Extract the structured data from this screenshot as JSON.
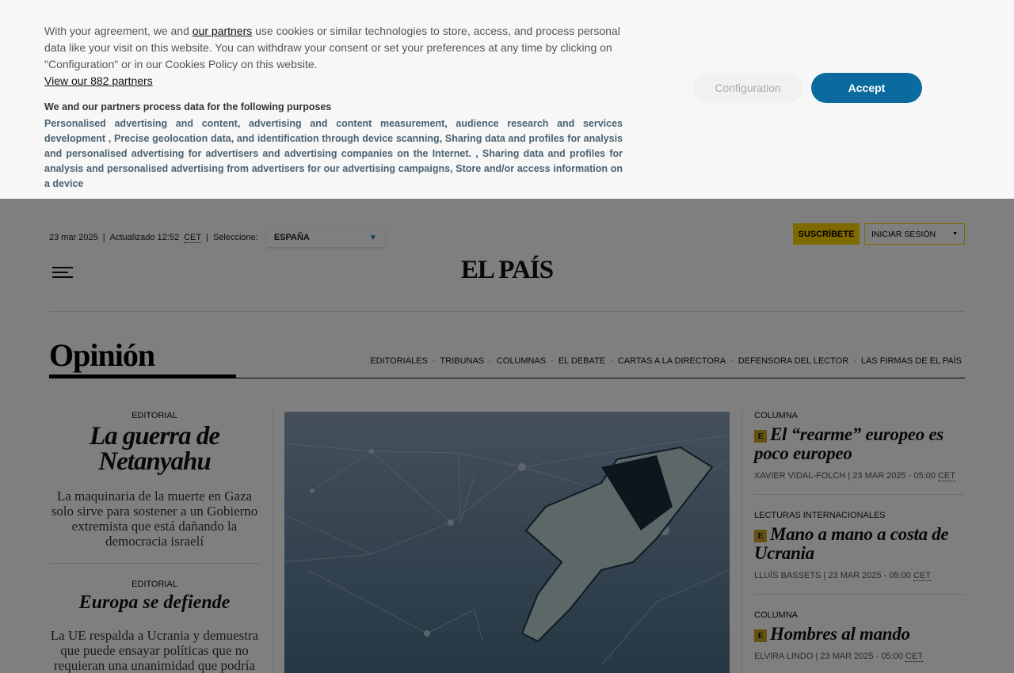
{
  "consent": {
    "text_before": "With your agreement, we and ",
    "partners_link": "our partners",
    "text_after": " use cookies or similar technologies to store, access, and process personal data like your visit on this website. You can withdraw your consent or set your preferences at any time by clicking on \"Configuration\" or in our Cookies Policy on this website.",
    "view_partners": "View our 882 partners",
    "purposes_heading": "We and our partners process data for the following purposes",
    "purposes": "Personalised advertising and content, advertising and content measurement, audience research and services development , Precise geolocation data, and identification through device scanning, Sharing data and profiles for analysis and personalised advertising for advertisers and advertising companies on the Internet. , Sharing data and profiles for analysis and personalised advertising from advertisers for our advertising campaigns, Store and/or access information on a device",
    "configuration": "Configuration",
    "accept": "Accept",
    "accent": "#0b6a9e"
  },
  "header": {
    "date": "23 mar 2025",
    "sep": "|",
    "updated": "Actualizado 12:52",
    "tz": "CET",
    "select_label": "Seleccione:",
    "edition": "ESPAÑA",
    "subscribe": "SUSCRÍBETE",
    "login": "INICIAR SESIÓN",
    "logo": "EL PAÍS",
    "subscribe_color": "#ffd400"
  },
  "section": {
    "title": "Opinión",
    "nav": [
      "EDITORIALES",
      "TRIBUNAS",
      "COLUMNAS",
      "EL DEBATE",
      "CARTAS A LA DIRECTORA",
      "DEFENSORA DEL LECTOR",
      "LAS FIRMAS DE EL PAÍS"
    ]
  },
  "left": [
    {
      "kicker": "EDITORIAL",
      "title": "La guerra de Netanyahu",
      "dek": "La maquinaria de la muerte en Gaza solo sirve para sostener a un Gobierno extremista que está dañando la democracia israelí"
    },
    {
      "kicker": "EDITORIAL",
      "title": "Europa se defiende",
      "dek": "La UE respalda a Ucrania y demuestra que puede ensayar políticas que no requieran una unanimidad que podría"
    }
  ],
  "right": [
    {
      "kicker": "COLUMNA",
      "badge": "E",
      "title": "El “rearme” europeo es poco europeo",
      "author": "XAVIER VIDAL-FOLCH",
      "date": "23 MAR 2025 - 05:00",
      "tz": "CET"
    },
    {
      "kicker": "LECTURAS INTERNACIONALES",
      "badge": "E",
      "title": "Mano a mano a costa de Ucrania",
      "author": "LLUÍS BASSETS",
      "date": "23 MAR 2025 - 05:00",
      "tz": "CET"
    },
    {
      "kicker": "COLUMNA",
      "badge": "E",
      "title": "Hombres al mando",
      "author": "ELVIRA LINDO",
      "date": "23 MAR 2025 - 05:00",
      "tz": "CET"
    }
  ]
}
